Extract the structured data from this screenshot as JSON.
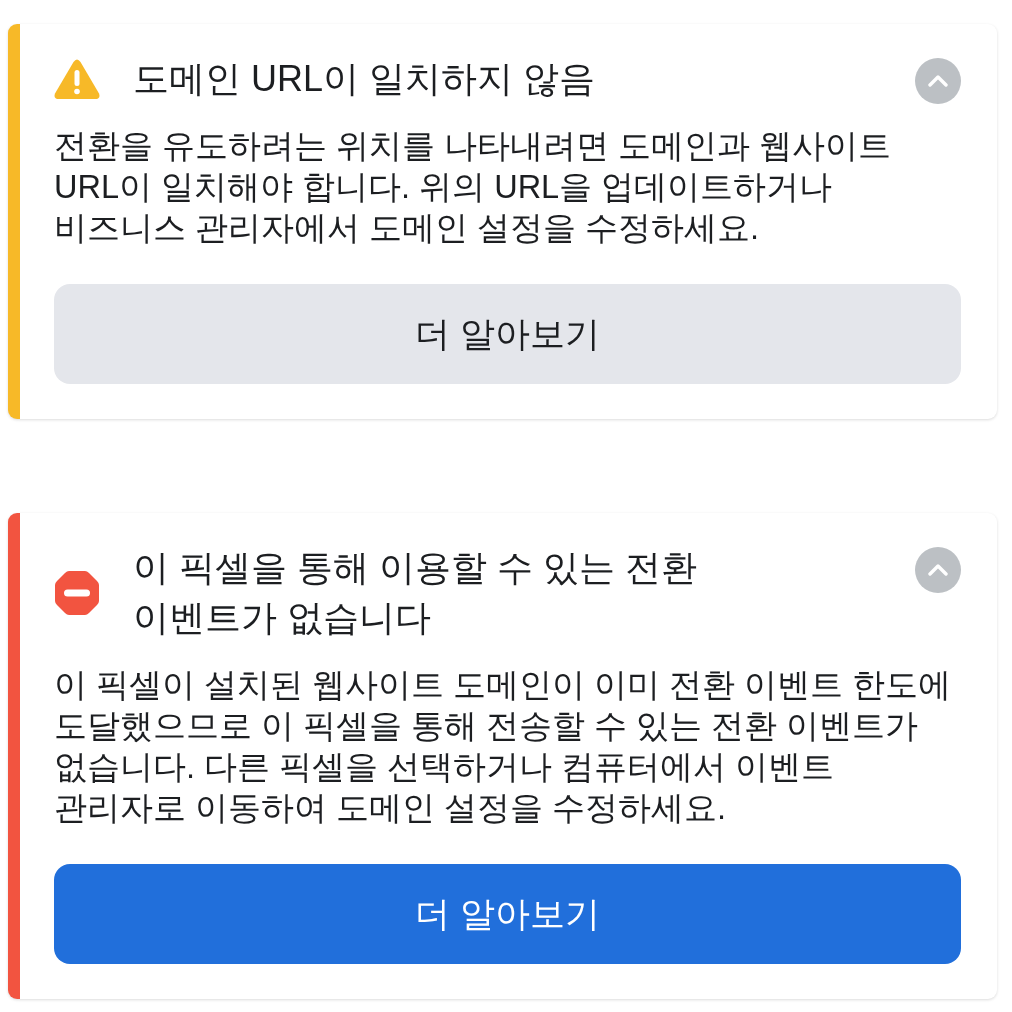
{
  "alerts": [
    {
      "kind": "warning",
      "title": "도메인 URL이 일치하지 않음",
      "expanded": true,
      "message": "전환을 유도하려는 위치를 나타내려면 도메인과 웹사이트 URL이 일치해야 합니다. 위의 URL을 업데이트하거나 비즈니스 관리자에서 도메인 설정을 수정하세요.",
      "button": {
        "label": "더 알아보기",
        "primary": false
      }
    },
    {
      "kind": "error",
      "title": "이 픽셀을 통해 이용할 수 있는 전환 이벤트가 없습니다",
      "expanded": true,
      "message": "이 픽셀이 설치된 웹사이트 도메인이 이미 전환 이벤트 한도에 도달했으므로 이 픽셀을 통해 전송할 수 있는 전환 이벤트가 없습니다. 다른 픽셀을 선택하거나 컴퓨터에서 이벤트 관리자로 이동하여 도메인 설정을 수정하세요.",
      "button": {
        "label": "더 알아보기",
        "primary": true
      }
    }
  ]
}
